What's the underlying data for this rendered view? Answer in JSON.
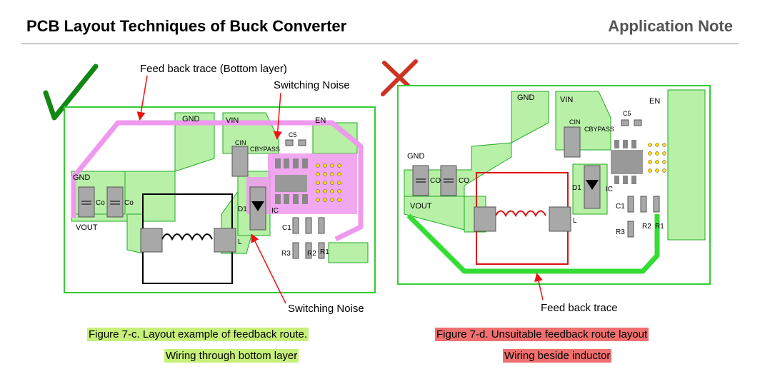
{
  "header": {
    "title": "PCB Layout Techniques of Buck Converter",
    "doc_type": "Application Note"
  },
  "left": {
    "labels": {
      "feedback_trace": "Feed back trace (Bottom layer)",
      "switching_noise_top": "Switching Noise",
      "switching_noise_bottom": "Switching Noise",
      "gnd_top": "GND",
      "vin": "VIN",
      "en": "EN",
      "gnd_left": "GND",
      "vout": "VOUT",
      "cin": "CIN",
      "cbypass": "CBYPASS",
      "c5": "C5",
      "co1": "Co",
      "co2": "Co",
      "d1": "D1",
      "ic": "IC",
      "l": "L",
      "c1": "C1",
      "r3": "R3",
      "r2": "R2",
      "r1": "R1"
    },
    "caption_line1": "Figure 7-c. Layout example of feedback route.",
    "caption_line2": "Wiring through bottom layer"
  },
  "right": {
    "labels": {
      "gnd_top": "GND",
      "vin": "VIN",
      "en": "EN",
      "gnd_left": "GND",
      "vout": "VOUT",
      "cin": "CIN",
      "cbypass": "CBYPASS",
      "c5": "C5",
      "co1": "CO",
      "co2": "CO",
      "d1": "D1",
      "ic": "IC",
      "l": "L",
      "c1": "C1",
      "r3": "R3",
      "r2": "R2",
      "r1": "R1",
      "feedback_trace": "Feed back trace"
    },
    "caption_line1": "Figure 7-d. Unsuitable feedback route layout",
    "caption_line2": "Wiring beside inductor"
  },
  "colors": {
    "board_border": "#33cc33",
    "copper": "#b8f0a8",
    "pink_trace": "#ee99ee",
    "bad_trace": "#33dd33",
    "check": "#118811",
    "cross": "#cc3322",
    "arrow": "#ee1111",
    "pad": "#a8a8a8",
    "caption_good": "#c6f07a",
    "caption_bad": "#f07070"
  }
}
